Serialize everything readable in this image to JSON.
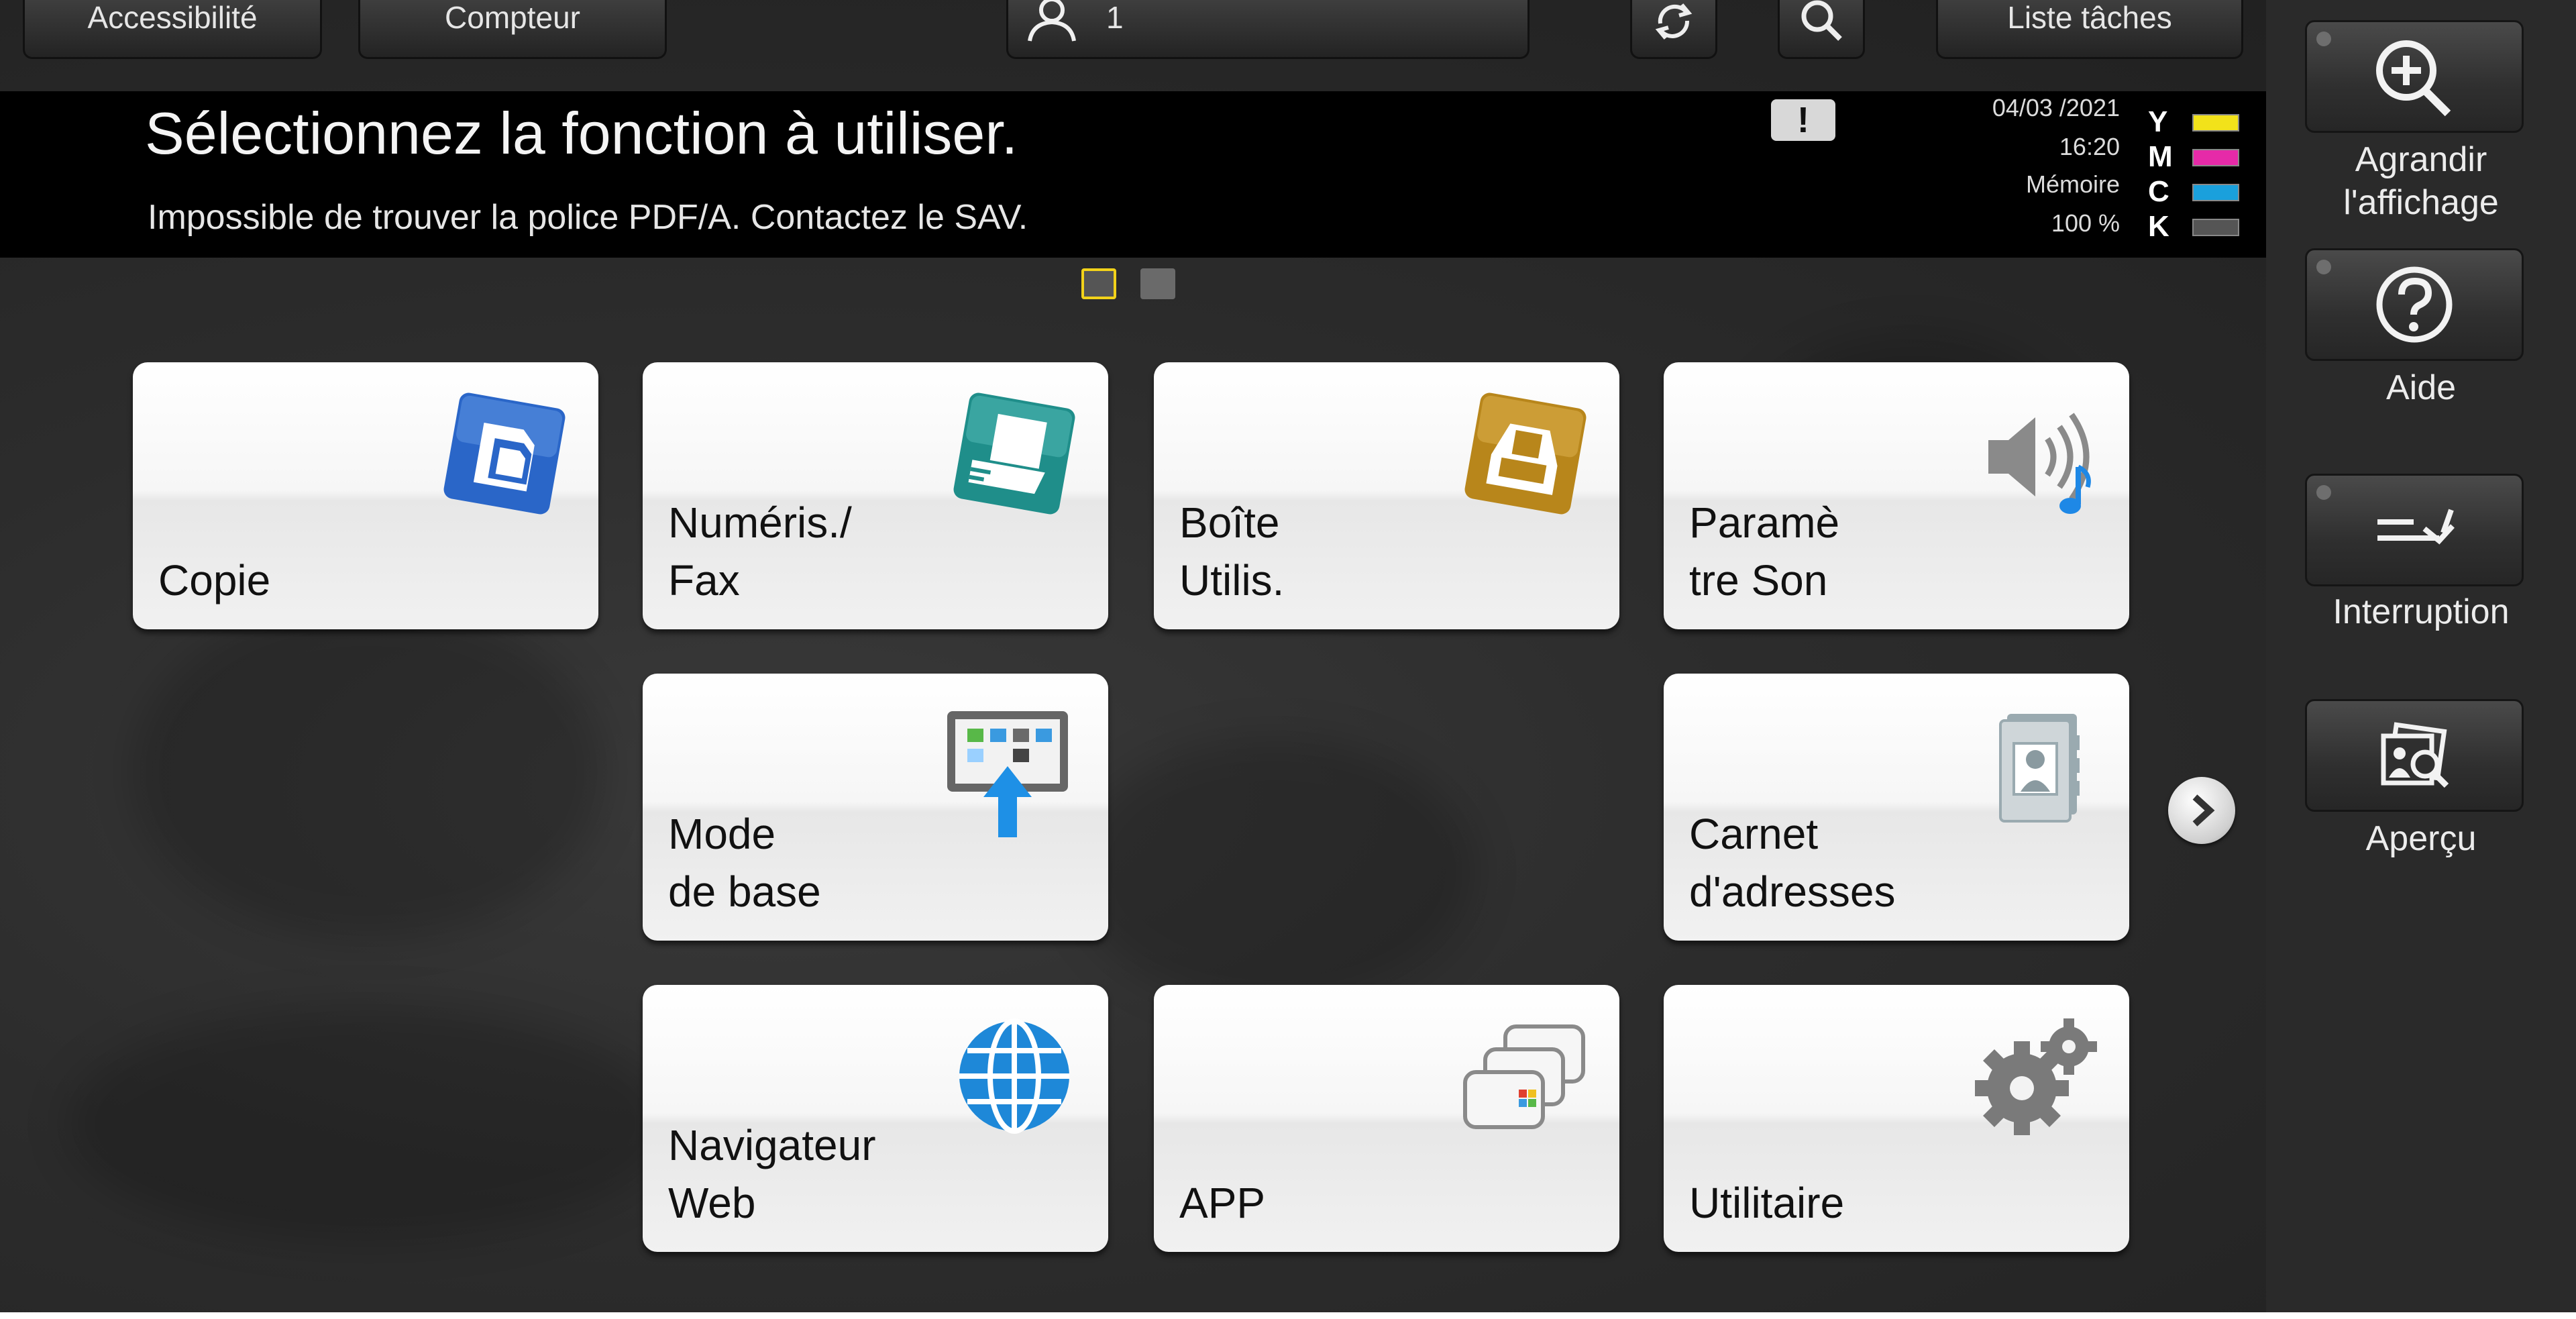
{
  "topbar": {
    "accessibility_label": "Accessibilité",
    "counter_label": "Compteur",
    "user_count": "1",
    "joblist_label": "Liste tâches"
  },
  "header": {
    "title": "Sélectionnez la fonction à utiliser.",
    "warning": "Impossible de trouver la police PDF/A. Contactez le SAV.",
    "warning_icon_glyph": "!",
    "date": "04/03 /2021",
    "time": "16:20",
    "memory_label": "Mémoire",
    "memory_value": "100 %",
    "toner": [
      {
        "letter": "Y",
        "color": "#f2e21a"
      },
      {
        "letter": "M",
        "color": "#e62aa8"
      },
      {
        "letter": "C",
        "color": "#1aa0dc"
      },
      {
        "letter": "K",
        "color": "#555555"
      }
    ]
  },
  "pager": {
    "active_color": "#f2d21a",
    "inactive_color": "#6a6a6a"
  },
  "tiles": [
    {
      "id": "copie",
      "label": "Copie",
      "icon": "copy-icon",
      "accent": "#2a66c8"
    },
    {
      "id": "numeris",
      "label": "Numéris./\nFax",
      "icon": "scan-fax-icon",
      "accent": "#1f8e8a"
    },
    {
      "id": "boite",
      "label": "Boîte\nUtilis.",
      "icon": "user-box-icon",
      "accent": "#b8861b"
    },
    {
      "id": "son",
      "label": "Paramè\ntre Son",
      "icon": "speaker-icon",
      "accent": "#9a9a9a"
    },
    {
      "id": "mode-base",
      "label": "Mode\nde base",
      "icon": "basic-mode-icon",
      "accent": "#1e90e6"
    },
    {
      "id": "carnet",
      "label": "Carnet\nd'adresses",
      "icon": "address-book-icon",
      "accent": "#8a9aa0"
    },
    {
      "id": "navigateur",
      "label": "Navigateur\nWeb",
      "icon": "globe-icon",
      "accent": "#1e88d8"
    },
    {
      "id": "app",
      "label": "APP",
      "icon": "app-icon",
      "accent": "#9a9a9a"
    },
    {
      "id": "utilitaire",
      "label": "Utilitaire",
      "icon": "gears-icon",
      "accent": "#8a8a8a"
    }
  ],
  "sidebar": {
    "zoom_label": "Agrandir\nl'affichage",
    "help_label": "Aide",
    "interrupt_label": "Interruption",
    "preview_label": "Aperçu"
  }
}
